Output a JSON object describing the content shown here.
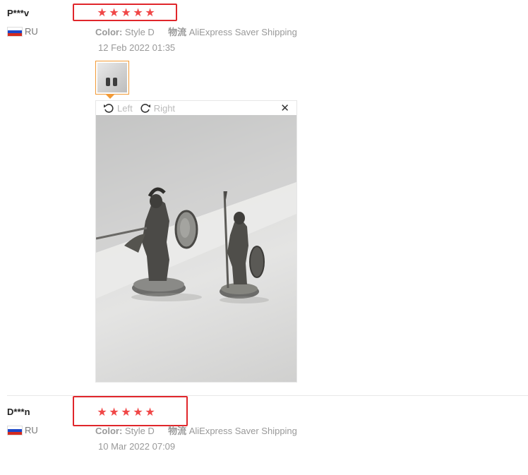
{
  "reviews": [
    {
      "user": "P***v",
      "country": "RU",
      "rating": 5,
      "stars": [
        "★",
        "★",
        "★",
        "★",
        "★"
      ],
      "color_label": "Color:",
      "color_value": "Style D",
      "shipping_label": "物流",
      "shipping_value": "AliExpress Saver Shipping",
      "date": "12 Feb 2022 01:35"
    },
    {
      "user": "D***n",
      "country": "RU",
      "rating": 5,
      "stars": [
        "★",
        "★",
        "★",
        "★",
        "★"
      ],
      "color_label": "Color:",
      "color_value": "Style D",
      "shipping_label": "物流",
      "shipping_value": "AliExpress Saver Shipping",
      "date": "10 Mar 2022 07:09"
    }
  ],
  "viewer": {
    "rotate_left": "Left",
    "rotate_right": "Right",
    "close_glyph": "✕"
  },
  "colors": {
    "star": "#f04747",
    "highlight_box": "#e0262b",
    "thumb_border": "#f29a36"
  }
}
